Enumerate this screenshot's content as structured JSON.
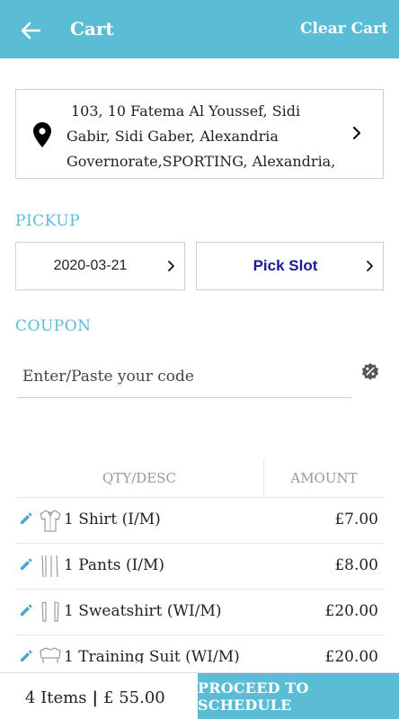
{
  "appbar": {
    "title": "Cart",
    "clear_label": "Clear Cart",
    "color": "#5bbcd6"
  },
  "address": {
    "line1": "103, 10 Fatema Al Youssef, Sidi",
    "line2": "Gabir, Sidi Gaber, Alexandria",
    "line3": "Governorate,SPORTING, Alexandria,"
  },
  "pickup": {
    "label": "PICKUP",
    "date": "2020-03-21",
    "slot_label": "Pick Slot"
  },
  "coupon": {
    "label": "COUPON",
    "placeholder": "Enter/Paste your code",
    "value": ""
  },
  "table": {
    "headers": [
      "QTY/DESC",
      "AMOUNT"
    ],
    "rows": [
      {
        "desc": "1 Shirt (I/M)",
        "amount": "£7.00",
        "icon": "shirt-icon"
      },
      {
        "desc": "1 Pants (I/M)",
        "amount": "£8.00",
        "icon": "pants-icon"
      },
      {
        "desc": "1 Sweatshirt (WI/M)",
        "amount": "£20.00",
        "icon": "sweatshirt-icon"
      },
      {
        "desc": "1 Training Suit (WI/M)",
        "amount": "£20.00",
        "icon": "training-suit-icon"
      }
    ]
  },
  "footer": {
    "items": "4 Items",
    "separator": "|",
    "total": "£ 55.00",
    "proceed_label": "PROCEED TO SCHEDULE"
  }
}
